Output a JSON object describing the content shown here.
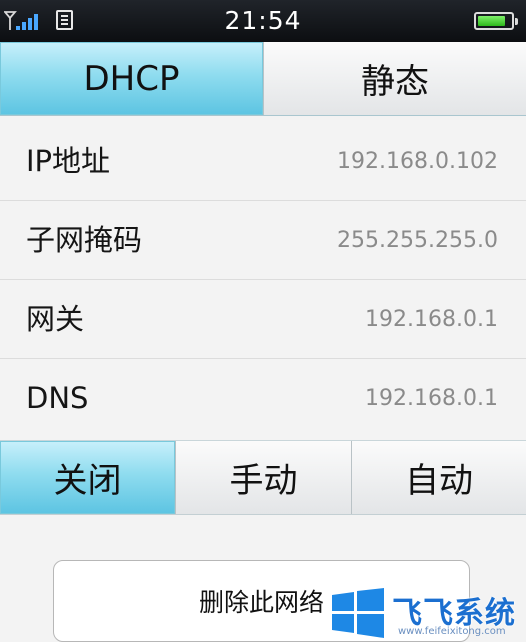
{
  "status_bar": {
    "time": "21:54",
    "signal_bars": 4,
    "battery_level": 0.85,
    "icons": [
      "signal-icon",
      "sim-icon",
      "battery-icon"
    ]
  },
  "mode_tabs": [
    {
      "label": "DHCP",
      "active": true
    },
    {
      "label": "静态",
      "active": false
    }
  ],
  "network_info": [
    {
      "label": "IP地址",
      "value": "192.168.0.102"
    },
    {
      "label": "子网掩码",
      "value": "255.255.255.0"
    },
    {
      "label": "网关",
      "value": "192.168.0.1"
    },
    {
      "label": "DNS",
      "value": "192.168.0.1"
    }
  ],
  "proxy_tabs": [
    {
      "label": "关闭",
      "active": true
    },
    {
      "label": "手动",
      "active": false
    },
    {
      "label": "自动",
      "active": false
    }
  ],
  "delete_button": {
    "label": "删除此网络"
  },
  "watermark": {
    "title": "飞飞系统",
    "url": "www.feifeixitong.com",
    "icon": "windows-logo-icon"
  },
  "colors": {
    "accent_active": "#8fdcef",
    "value_text": "#8a8a8a",
    "watermark_blue": "#1b6fd0"
  }
}
